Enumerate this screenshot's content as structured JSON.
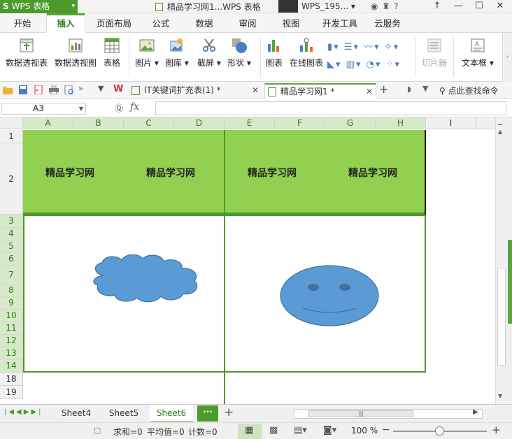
{
  "app": {
    "name": "WPS 表格",
    "logo": "S",
    "window_title": "精品学习网1...WPS 表格"
  },
  "user": {
    "name": "WPS_195..."
  },
  "window_controls": [
    "↑",
    "—",
    "☐",
    "✕"
  ],
  "menu": {
    "tabs": [
      "开始",
      "插入",
      "页面布局",
      "公式",
      "数据",
      "审阅",
      "视图",
      "开发工具",
      "云服务"
    ],
    "active": "插入"
  },
  "ribbon": {
    "buttons": [
      {
        "label": "数据透视表",
        "icon": "pivot-table-icon"
      },
      {
        "label": "数据透视图",
        "icon": "pivot-chart-icon"
      },
      {
        "label": "表格",
        "icon": "table-icon"
      },
      {
        "label": "图片",
        "icon": "picture-icon",
        "dropdown": "▾"
      },
      {
        "label": "图库",
        "icon": "gallery-icon",
        "dropdown": "▾"
      },
      {
        "label": "截屏",
        "icon": "screenshot-icon",
        "dropdown": "▾"
      },
      {
        "label": "形状",
        "icon": "shapes-icon",
        "dropdown": "▾"
      },
      {
        "label": "图表",
        "icon": "chart-icon"
      },
      {
        "label": "在线图表",
        "icon": "online-chart-icon"
      },
      {
        "label": "切片器",
        "icon": "slicer-icon"
      },
      {
        "label": "文本框",
        "icon": "textbox-icon",
        "dropdown": "▾"
      }
    ]
  },
  "doc_tabs": [
    {
      "label": "IT关键词扩充表(1) *",
      "active": false
    },
    {
      "label": "精品学习网1 *",
      "active": true
    }
  ],
  "quickbar": {
    "search_label": "点此查找命令"
  },
  "formula_bar": {
    "cell_ref": "A3",
    "fx_label": "fx",
    "value": ""
  },
  "columns": [
    "A",
    "B",
    "C",
    "D",
    "E",
    "F",
    "G",
    "H",
    "I"
  ],
  "rows": [
    "1",
    "2",
    "3",
    "4",
    "5",
    "6",
    "7",
    "8",
    "9",
    "10",
    "11",
    "12",
    "13",
    "14",
    "18",
    "19"
  ],
  "header_cells": [
    "精品学习网",
    "精品学习网",
    "精品学习网",
    "精品学习网"
  ],
  "shapes": [
    {
      "name": "cloud-shape",
      "fill": "#5b9bd5"
    },
    {
      "name": "smiley-face-shape",
      "fill": "#5b9bd5"
    }
  ],
  "sheets": {
    "tabs": [
      "Sheet4",
      "Sheet5",
      "Sheet6"
    ],
    "active": "Sheet6",
    "more_label": "···",
    "add_label": "+"
  },
  "status": {
    "sum": "求和=0",
    "average": "平均值=0",
    "count": "计数=0",
    "zoom": "100 %"
  },
  "colors": {
    "brand_green": "#4c9a2a",
    "header_fill": "#92d050",
    "shape_blue": "#5b9bd5"
  }
}
